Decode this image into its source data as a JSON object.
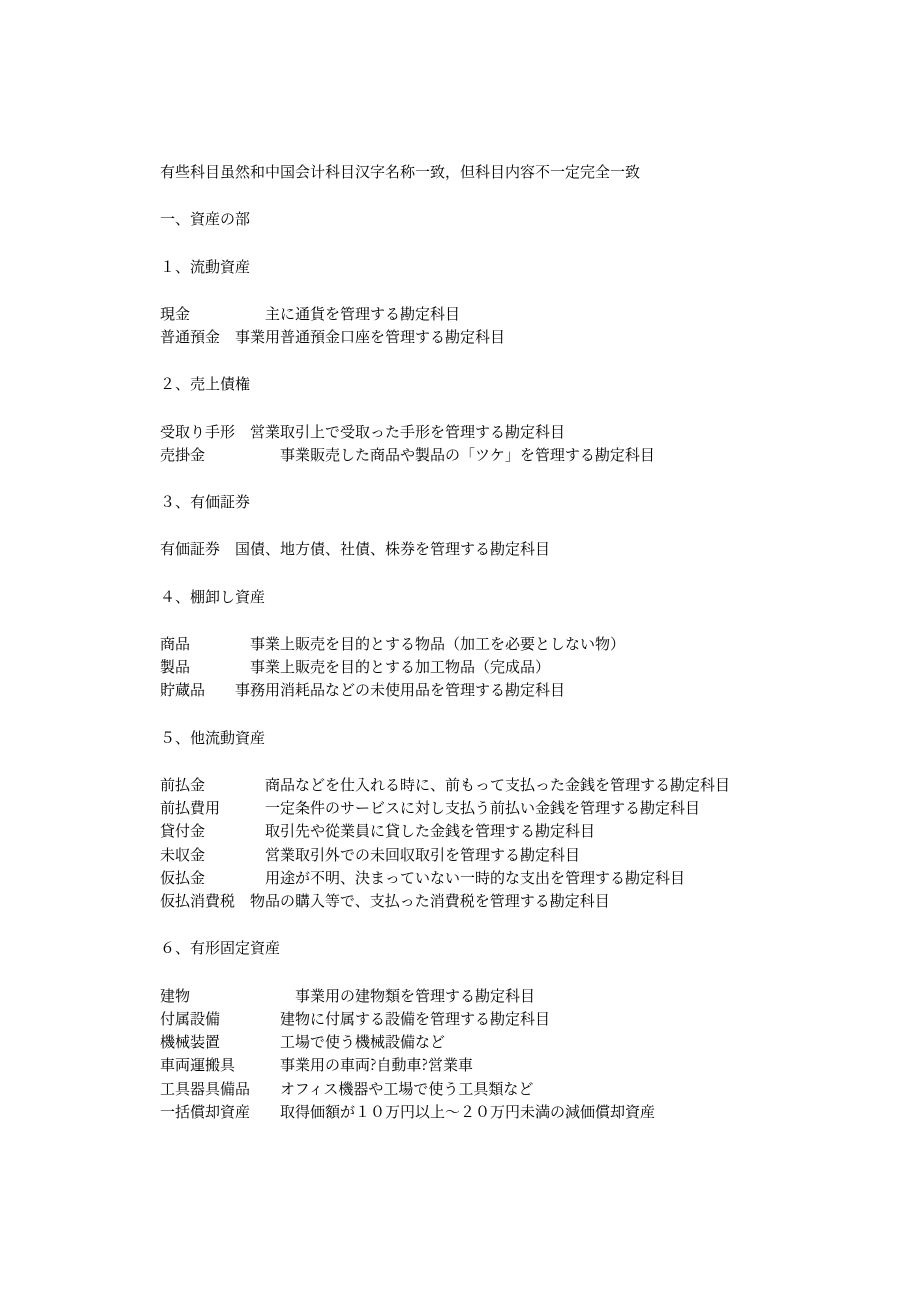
{
  "intro": "有些科目虽然和中国会计科目汉字名称一致，但科目内容不一定完全一致",
  "section_heading": "一、資産の部",
  "groups": [
    {
      "heading": "１、流動資産",
      "rows": [
        {
          "term": "現金",
          "pad": "　　　　　",
          "desc": "主に通貨を管理する勘定科目"
        },
        {
          "term": "普通預金",
          "pad": "　",
          "desc": "事業用普通預金口座を管理する勘定科目"
        }
      ]
    },
    {
      "heading": "２、売上債権",
      "rows": [
        {
          "term": "受取り手形",
          "pad": "　",
          "desc": "営業取引上で受取った手形を管理する勘定科目"
        },
        {
          "term": "売掛金",
          "pad": "　　　　　",
          "desc": "事業販売した商品や製品の「ツケ」を管理する勘定科目"
        }
      ]
    },
    {
      "heading": "３、有価証券",
      "rows": [
        {
          "term": "有価証券",
          "pad": "　",
          "desc": "国債、地方債、社債、株券を管理する勘定科目"
        }
      ]
    },
    {
      "heading": "４、棚卸し資産",
      "rows": [
        {
          "term": "商品",
          "pad": "　　　　",
          "desc": "事業上販売を目的とする物品（加工を必要としない物）"
        },
        {
          "term": "製品",
          "pad": "　　　　",
          "desc": "事業上販売を目的とする加工物品（完成品）"
        },
        {
          "term": "貯蔵品",
          "pad": "　　",
          "desc": "事務用消耗品などの未使用品を管理する勘定科目"
        }
      ]
    },
    {
      "heading": "５、他流動資産",
      "rows": [
        {
          "term": "前払金",
          "pad": "　　　　",
          "desc": "商品などを仕入れる時に、前もって支払った金銭を管理する勘定科目"
        },
        {
          "term": "前払費用",
          "pad": "　　　",
          "desc": "一定条件のサービスに対し支払う前払い金銭を管理する勘定科目"
        },
        {
          "term": "貸付金",
          "pad": "　　　　",
          "desc": "取引先や從業員に貸した金銭を管理する勘定科目"
        },
        {
          "term": "未収金",
          "pad": "　　　　",
          "desc": "営業取引外での未回収取引を管理する勘定科目"
        },
        {
          "term": "仮払金",
          "pad": "　　　　",
          "desc": "用途が不明、決まっていない一時的な支出を管理する勘定科目"
        },
        {
          "term": "仮払消費税",
          "pad": "　",
          "desc": "物品の購入等で、支払った消費税を管理する勘定科目"
        }
      ]
    },
    {
      "heading": "６、有形固定資産",
      "rows": [
        {
          "term": "建物",
          "pad": "　　　　　　　",
          "desc": "事業用の建物類を管理する勘定科目"
        },
        {
          "term": "付属設備",
          "pad": "　　　　",
          "desc": "建物に付属する設備を管理する勘定科目"
        },
        {
          "term": "機械装置",
          "pad": "　　　　",
          "desc": "工場で使う機械設備など"
        },
        {
          "term": "車両運搬具",
          "pad": "　　　",
          "desc": "事業用の車両?自動車?営業車"
        },
        {
          "term": "工具器具備品",
          "pad": "　　",
          "desc": "オフィス機器や工場で使う工具類など"
        },
        {
          "term": "一括償却資産",
          "pad": "　　",
          "desc": "取得価額が１０万円以上～２０万円未満の減価償却資産"
        }
      ]
    }
  ]
}
